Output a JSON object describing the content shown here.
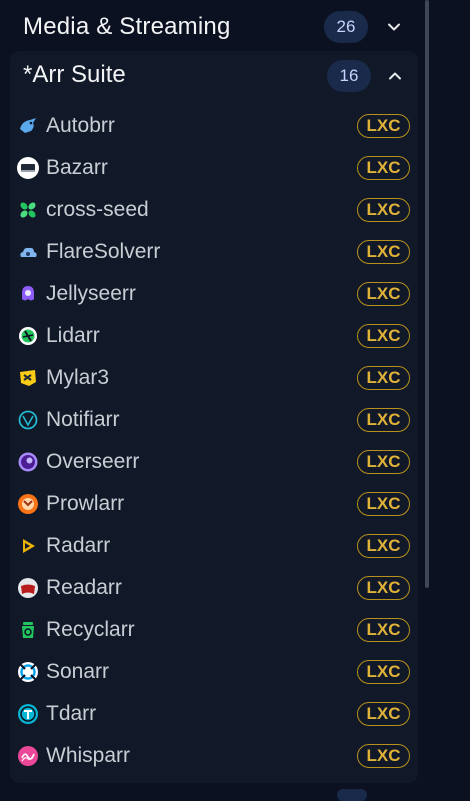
{
  "category": {
    "title": "Media & Streaming",
    "count": "26"
  },
  "group": {
    "title": "*Arr Suite",
    "count": "16"
  },
  "badge_label": "LXC",
  "items": [
    {
      "label": "Autobrr",
      "icon": "autobrr-icon",
      "color": "#4fa3e8"
    },
    {
      "label": "Bazarr",
      "icon": "bazarr-icon",
      "color": "#ffffff"
    },
    {
      "label": "cross-seed",
      "icon": "cross-seed-icon",
      "color": "#22c55e"
    },
    {
      "label": "FlareSolverr",
      "icon": "flaresolverr-icon",
      "color": "#7fb4ee"
    },
    {
      "label": "Jellyseerr",
      "icon": "jellyseerr-icon",
      "color": "#8b5cf6"
    },
    {
      "label": "Lidarr",
      "icon": "lidarr-icon",
      "color": "#22c55e"
    },
    {
      "label": "Mylar3",
      "icon": "mylar3-icon",
      "color": "#facc15"
    },
    {
      "label": "Notifiarr",
      "icon": "notifiarr-icon",
      "color": "#22b8cf"
    },
    {
      "label": "Overseerr",
      "icon": "overseerr-icon",
      "color": "#7c3aed"
    },
    {
      "label": "Prowlarr",
      "icon": "prowlarr-icon",
      "color": "#f97316"
    },
    {
      "label": "Radarr",
      "icon": "radarr-icon",
      "color": "#eab308"
    },
    {
      "label": "Readarr",
      "icon": "readarr-icon",
      "color": "#b91c1c"
    },
    {
      "label": "Recyclarr",
      "icon": "recyclarr-icon",
      "color": "#22c55e"
    },
    {
      "label": "Sonarr",
      "icon": "sonarr-icon",
      "color": "#38bdf8"
    },
    {
      "label": "Tdarr",
      "icon": "tdarr-icon",
      "color": "#06b6d4"
    },
    {
      "label": "Whisparr",
      "icon": "whisparr-icon",
      "color": "#ec4899"
    }
  ]
}
